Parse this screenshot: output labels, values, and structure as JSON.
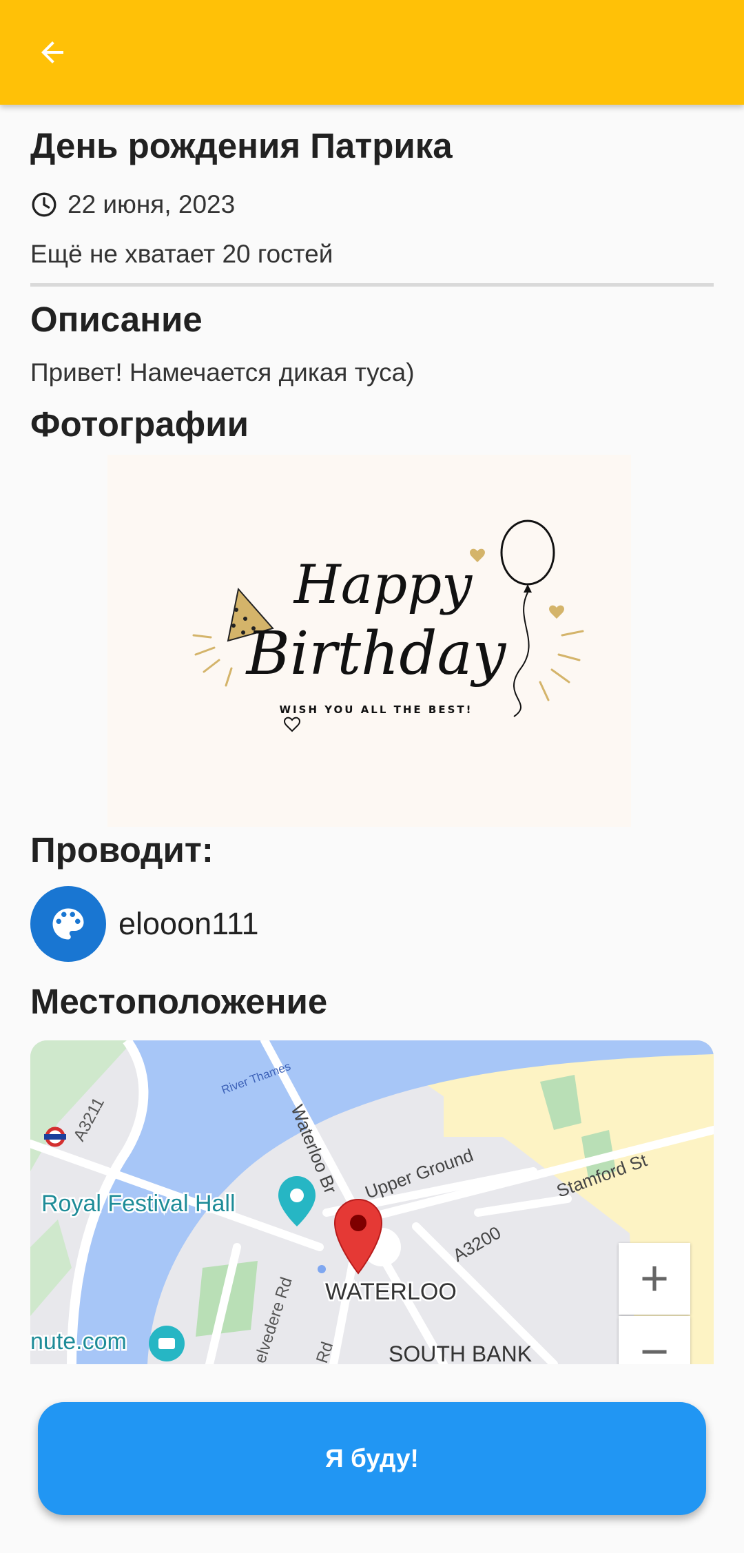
{
  "appbar": {
    "back_icon": "arrow-back-icon",
    "color": "#ffc107"
  },
  "event": {
    "title": "День рождения Патрика",
    "date": "22 июня, 2023",
    "date_icon": "clock-icon",
    "guests_needed": "Ещё не хватает 20 гостей"
  },
  "description": {
    "heading": "Описание",
    "text": "Привет! Намечается дикая туса)"
  },
  "photos": {
    "heading": "Фотографии",
    "card": {
      "line1": "Happy",
      "line2": "Birthday",
      "tagline": "WISH YOU ALL THE BEST!"
    }
  },
  "host": {
    "heading": "Проводит:",
    "name": "elooon111",
    "avatar_icon": "palette-icon",
    "avatar_color": "#1976d2"
  },
  "location": {
    "heading": "Местоположение",
    "map_labels": {
      "river": "River Thames",
      "a3211": "A3211",
      "waterloo_br": "Waterloo Br",
      "upper_ground": "Upper Ground",
      "stamford": "Stamford St",
      "royal_festival": "Royal Festival Hall",
      "a3200": "A3200",
      "waterloo": "WATERLOO",
      "belvedere": "elvedere Rd",
      "rd": "Rd",
      "south_bank": "SOUTH BANK",
      "nute": "nute.com"
    },
    "zoom_in": "+",
    "zoom_out": "−"
  },
  "cta": {
    "label": "Я буду!",
    "color": "#2196f3"
  }
}
